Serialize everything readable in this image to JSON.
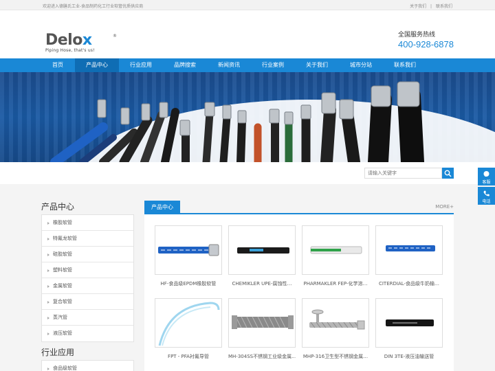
{
  "topbar": {
    "welcome": "欢迎进入德膳氏工业-食品制药化工行业软管优质供应商",
    "links": [
      "关于我们",
      "|",
      "联系我们"
    ]
  },
  "header": {
    "logo_text_a": "Delo",
    "logo_text_b": "x",
    "logo_reg": "®",
    "tagline": "Piping Hose, that's us!",
    "hotline_label": "全国服务热线",
    "hotline_phone": "400-928-6878"
  },
  "nav": {
    "items": [
      "首页",
      "产品中心",
      "行业应用",
      "品牌搜索",
      "新闻资讯",
      "行业案例",
      "关于我们",
      "城市分站",
      "联系我们"
    ],
    "active_index": 1
  },
  "search": {
    "placeholder": "请输入关键字"
  },
  "float": {
    "service_label": "客服",
    "phone_label": "电话"
  },
  "sidebar": {
    "title": "产品中心",
    "items": [
      "橡胶软管",
      "特氟龙软管",
      "硅胶软管",
      "塑料软管",
      "金属软管",
      "复合软管",
      "蒸汽管",
      "液压软管"
    ],
    "title2": "行业应用",
    "items2": [
      "食品级软管"
    ]
  },
  "main": {
    "tab": "产品中心",
    "more": "MORE+",
    "products": [
      {
        "name": "HF-食品级EPDM橡胶软管",
        "hose_color": "#1f62c4",
        "stripe": "#ffffff"
      },
      {
        "name": "CHEMIKLER UPE-腐蚀性…",
        "hose_color": "#1b1b1b",
        "stripe": "#3aa0d8"
      },
      {
        "name": "PHARMAKLER FEP-化学溶…",
        "hose_color": "#e9e9e9",
        "stripe": "#2fa24a"
      },
      {
        "name": "CITERDIAL-食品级牛奶输…",
        "hose_color": "#1f62c4",
        "stripe": "#ffffff"
      },
      {
        "name": "FPT - PFA衬氟导管",
        "hose_color": "#9fd6ef",
        "stripe": "#9fd6ef"
      },
      {
        "name": "MH-304SS不锈钢工业级金属…",
        "hose_color": "#8a8a8a",
        "stripe": "#6a6a6a"
      },
      {
        "name": "MHP-316卫生型不锈钢金属…",
        "hose_color": "#b5b5b5",
        "stripe": "#8a8a8a"
      },
      {
        "name": "DIN 3TE-液压油输送管",
        "hose_color": "#151515",
        "stripe": "#cccccc"
      }
    ]
  }
}
